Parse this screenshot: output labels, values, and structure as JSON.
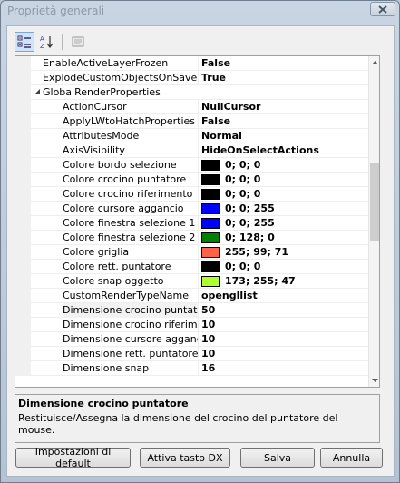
{
  "window": {
    "title": "Proprietà generali"
  },
  "grid": {
    "rows": [
      {
        "name": "EnableActiveLayerFrozen",
        "value": "False",
        "kind": "top"
      },
      {
        "name": "ExplodeCustomObjectsOnSave",
        "value": "True",
        "kind": "top"
      },
      {
        "name": "GlobalRenderProperties",
        "value": "",
        "kind": "category"
      },
      {
        "name": "ActionCursor",
        "value": "NullCursor",
        "kind": "child"
      },
      {
        "name": "ApplyLWtoHatchProperties",
        "value": "False",
        "kind": "child"
      },
      {
        "name": "AttributesMode",
        "value": "Normal",
        "kind": "child"
      },
      {
        "name": "AxisVisibility",
        "value": "HideOnSelectActions",
        "kind": "child"
      },
      {
        "name": "Colore bordo selezione",
        "value": "0; 0; 0",
        "kind": "child",
        "swatch": "#000000"
      },
      {
        "name": "Colore crocino puntatore",
        "value": "0; 0; 0",
        "kind": "child",
        "swatch": "#000000"
      },
      {
        "name": "Colore crocino riferimento",
        "value": "0; 0; 0",
        "kind": "child",
        "swatch": "#000000"
      },
      {
        "name": "Colore cursore aggancio",
        "value": "0; 0; 255",
        "kind": "child",
        "swatch": "#0000ff"
      },
      {
        "name": "Colore finestra selezione 1",
        "value": "0; 0; 255",
        "kind": "child",
        "swatch": "#0000ff"
      },
      {
        "name": "Colore finestra selezione 2",
        "value": "0; 128; 0",
        "kind": "child",
        "swatch": "#008000"
      },
      {
        "name": "Colore griglia",
        "value": "255; 99; 71",
        "kind": "child",
        "swatch": "#ff6347"
      },
      {
        "name": "Colore rett. puntatore",
        "value": "0; 0; 0",
        "kind": "child",
        "swatch": "#000000"
      },
      {
        "name": "Colore snap oggetto",
        "value": "173; 255; 47",
        "kind": "child",
        "swatch": "#adff2f"
      },
      {
        "name": "CustomRenderTypeName",
        "value": "opengllist",
        "kind": "child"
      },
      {
        "name": "Dimensione crocino puntatore",
        "value": "50",
        "kind": "child",
        "selected": true
      },
      {
        "name": "Dimensione crocino riferimento",
        "value": "10",
        "kind": "child"
      },
      {
        "name": "Dimensione cursore aggancio",
        "value": "10",
        "kind": "child"
      },
      {
        "name": "Dimensione rett. puntatore",
        "value": "10",
        "kind": "child"
      },
      {
        "name": "Dimensione snap",
        "value": "16",
        "kind": "child"
      }
    ]
  },
  "help": {
    "title": "Dimensione crocino puntatore",
    "text": "Restituisce/Assegna la dimensione del crocino del puntatore del mouse."
  },
  "buttons": {
    "defaults": "Impostazioni di default",
    "activate_dx": "Attiva tasto DX",
    "save": "Salva",
    "cancel": "Annulla"
  },
  "icons": {
    "close": "close-icon",
    "categorized": "categorized-icon",
    "alphabetical": "alphabetical-sort-icon",
    "property_pages": "property-pages-icon"
  }
}
